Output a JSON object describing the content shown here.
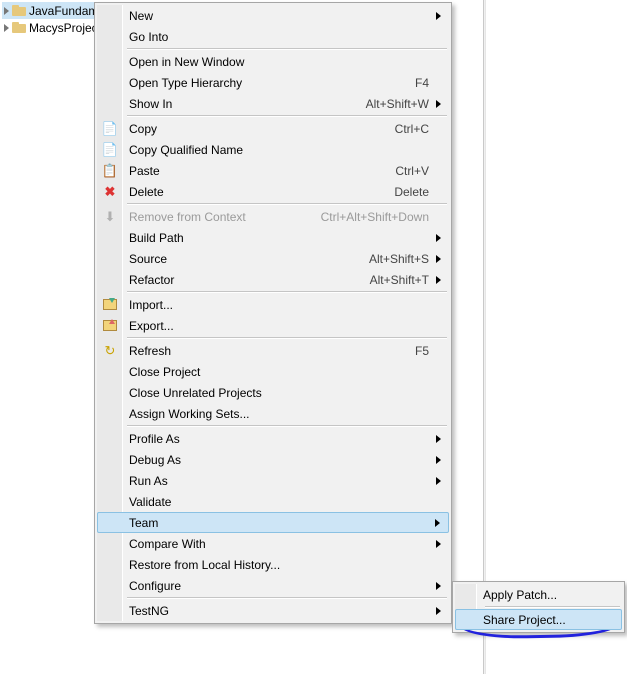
{
  "tree": {
    "items": [
      {
        "label": "JavaFundam"
      },
      {
        "label": "MacysProjec"
      }
    ]
  },
  "menu": {
    "g1": [
      {
        "label": "New",
        "shortcut": "",
        "submenu": true
      },
      {
        "label": "Go Into"
      }
    ],
    "g2": [
      {
        "label": "Open in New Window"
      },
      {
        "label": "Open Type Hierarchy",
        "shortcut": "F4"
      },
      {
        "label": "Show In",
        "shortcut": "Alt+Shift+W",
        "submenu": true
      }
    ],
    "g3": [
      {
        "label": "Copy",
        "shortcut": "Ctrl+C",
        "icon": "copy",
        "glyph": "📄"
      },
      {
        "label": "Copy Qualified Name",
        "icon": "copy",
        "glyph": "📄"
      },
      {
        "label": "Paste",
        "shortcut": "Ctrl+V",
        "icon": "paste",
        "glyph": "📋"
      },
      {
        "label": "Delete",
        "shortcut": "Delete",
        "icon": "delete",
        "glyph": "✖"
      }
    ],
    "g4": [
      {
        "label": "Remove from Context",
        "shortcut": "Ctrl+Alt+Shift+Down",
        "icon": "remove",
        "glyph": "⬇",
        "disabled": true
      },
      {
        "label": "Build Path",
        "submenu": true
      },
      {
        "label": "Source",
        "shortcut": "Alt+Shift+S",
        "submenu": true
      },
      {
        "label": "Refactor",
        "shortcut": "Alt+Shift+T",
        "submenu": true
      }
    ],
    "g5": [
      {
        "label": "Import...",
        "icon": "import"
      },
      {
        "label": "Export...",
        "icon": "export"
      }
    ],
    "g6": [
      {
        "label": "Refresh",
        "shortcut": "F5",
        "icon": "refresh",
        "glyph": "↻"
      },
      {
        "label": "Close Project"
      },
      {
        "label": "Close Unrelated Projects"
      },
      {
        "label": "Assign Working Sets..."
      }
    ],
    "g7": [
      {
        "label": "Profile As",
        "submenu": true
      },
      {
        "label": "Debug As",
        "submenu": true
      },
      {
        "label": "Run As",
        "submenu": true
      },
      {
        "label": "Validate"
      },
      {
        "label": "Team",
        "submenu": true,
        "hover": true
      },
      {
        "label": "Compare With",
        "submenu": true
      },
      {
        "label": "Restore from Local History..."
      },
      {
        "label": "Configure",
        "submenu": true
      }
    ],
    "g8": [
      {
        "label": "TestNG",
        "submenu": true
      }
    ]
  },
  "submenu": {
    "items": [
      {
        "label": "Apply Patch..."
      },
      {
        "label": "Share Project...",
        "hover": true
      }
    ]
  }
}
